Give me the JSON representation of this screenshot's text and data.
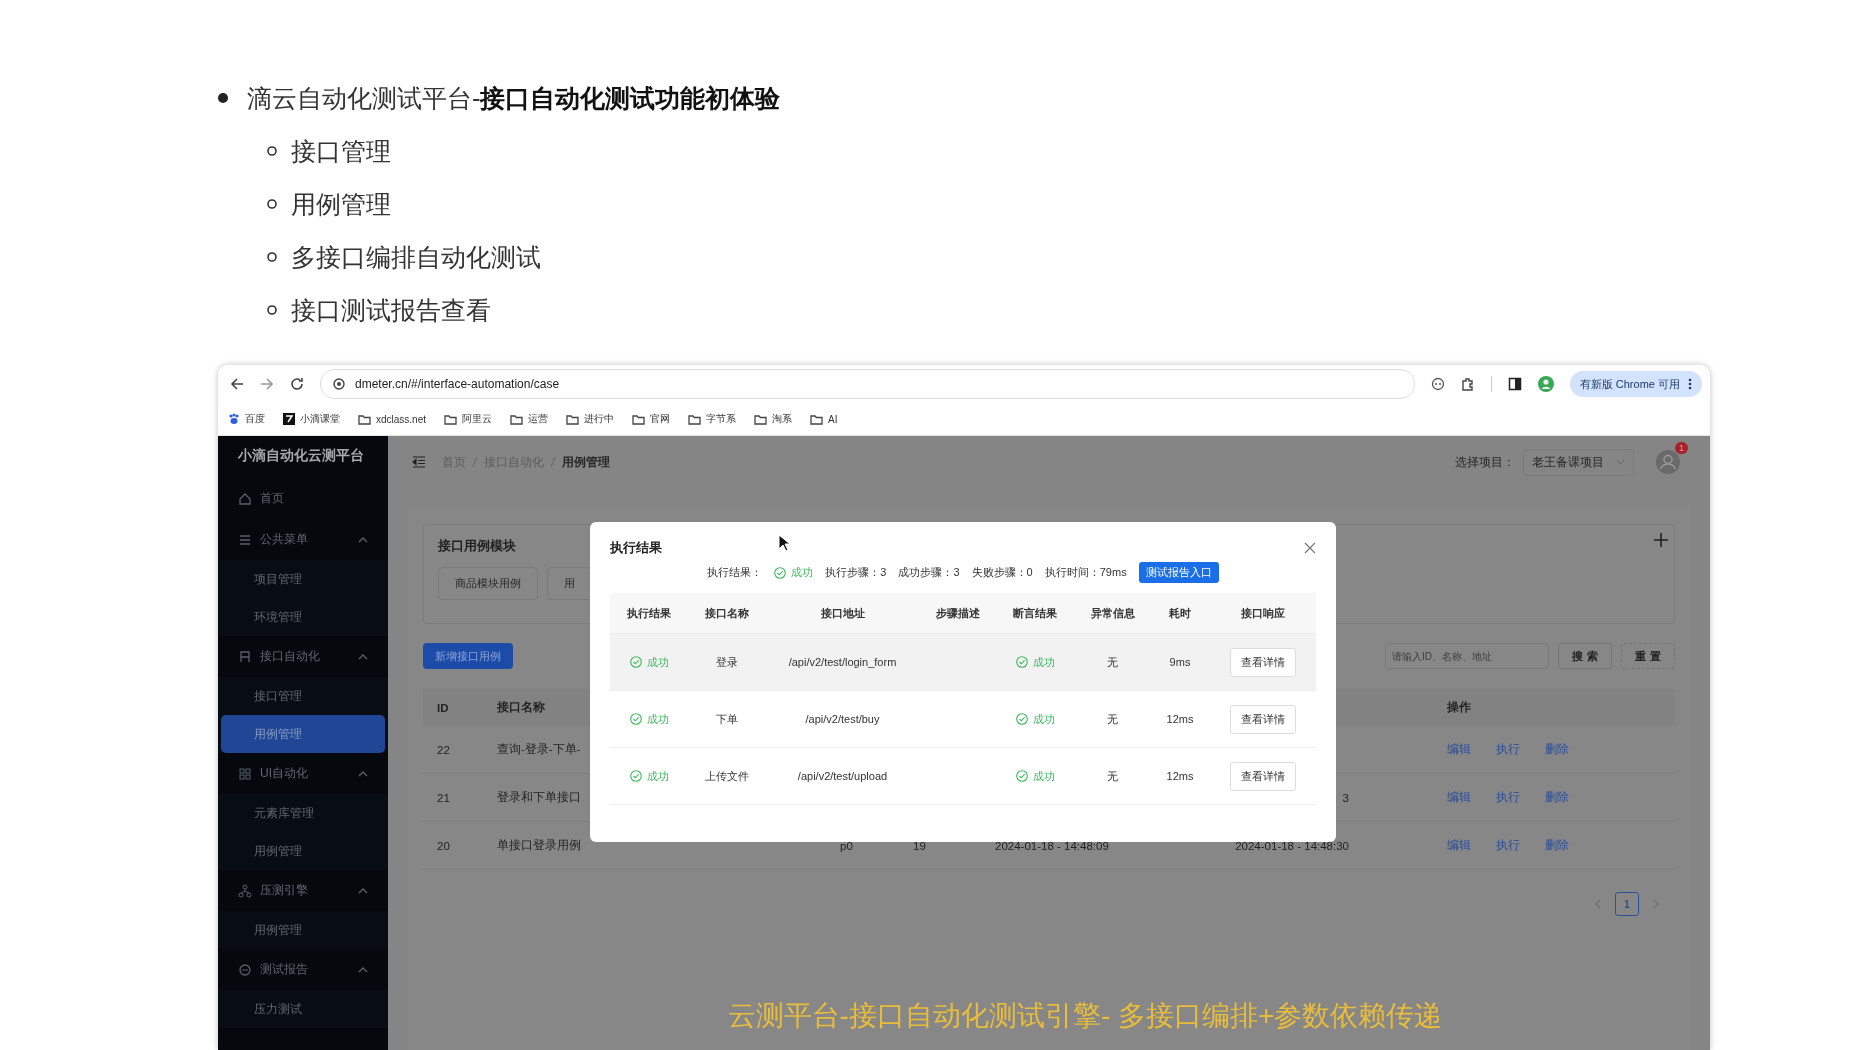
{
  "slide": {
    "heading": "滴云自动化测试平台-**接口自动化测试功能初体验**",
    "items": [
      "接口管理",
      "用例管理",
      "多接口编排自动化测试",
      "接口测试报告查看"
    ]
  },
  "browser": {
    "address": "dmeter.cn/#/interface-automation/case",
    "update_button": "有新版 Chrome 可用",
    "bookmarks": [
      {
        "label": "百度",
        "kind": "paw"
      },
      {
        "label": "小滴课堂",
        "kind": "logo"
      },
      {
        "label": "xdclass.net",
        "kind": "folder"
      },
      {
        "label": "阿里云",
        "kind": "folder"
      },
      {
        "label": "运营",
        "kind": "folder"
      },
      {
        "label": "进行中",
        "kind": "folder"
      },
      {
        "label": "官网",
        "kind": "folder"
      },
      {
        "label": "字节系",
        "kind": "folder"
      },
      {
        "label": "淘系",
        "kind": "folder"
      },
      {
        "label": "AI",
        "kind": "folder"
      }
    ]
  },
  "app": {
    "brand": "小滴自动化云测平台",
    "sidebar": {
      "items": [
        {
          "label": "首页",
          "selected": false
        },
        {
          "label": "公共菜单",
          "expanded": true,
          "children": [
            {
              "label": "项目管理",
              "selected": false
            },
            {
              "label": "环境管理",
              "selected": false
            }
          ]
        },
        {
          "label": "接口自动化",
          "expanded": true,
          "children": [
            {
              "label": "接口管理",
              "selected": false
            },
            {
              "label": "用例管理",
              "selected": true
            }
          ]
        },
        {
          "label": "UI自动化",
          "expanded": true,
          "children": [
            {
              "label": "元素库管理",
              "selected": false
            },
            {
              "label": "用例管理",
              "selected": false
            }
          ]
        },
        {
          "label": "压测引擎",
          "expanded": true,
          "children": [
            {
              "label": "用例管理",
              "selected": false
            }
          ]
        },
        {
          "label": "测试报告",
          "expanded": true,
          "children": [
            {
              "label": "压力测试",
              "selected": false
            }
          ]
        }
      ]
    },
    "header": {
      "breadcrumb": [
        "首页",
        "接口自动化",
        "用例管理"
      ],
      "project_label": "选择项目：",
      "project": "老王备课项目",
      "notification_count": "1"
    },
    "module_panel": {
      "title": "接口用例模块",
      "modules": [
        "商品模块用例",
        "用"
      ]
    },
    "add_button": "新增接口用例",
    "search": {
      "placeholder": "请输入ID、名称、地址"
    },
    "buttons": [
      "搜 索",
      "重 置"
    ],
    "table": {
      "columns": {
        "id": "ID",
        "name": "接口名称",
        "actions": "操作"
      },
      "rows": [
        {
          "id": "22",
          "name": "查询-登录-下单-",
          "actions": [
            "编辑",
            "执行",
            "删除"
          ]
        },
        {
          "id": "21",
          "name": "登录和下单接口",
          "column_6": "3",
          "actions": [
            "编辑",
            "执行",
            "删除"
          ]
        },
        {
          "id": "20",
          "name": "单接口登录用例",
          "column_3": "p0",
          "column_4": "19",
          "column_5": "2024-01-18 - 14:48:09",
          "column_6": "2024-01-18 - 14:48:30",
          "actions": [
            "编辑",
            "执行",
            "删除"
          ]
        }
      ]
    },
    "pagination": [
      {
        "label": "1",
        "selected": true
      }
    ],
    "modal": {
      "title": "执行结果",
      "summary": {
        "result_label": "执行结果：",
        "result": {
          "text": "成功",
          "success": true
        },
        "stats": [
          "执行步骤：3",
          "成功步骤：3",
          "失败步骤：0",
          "执行时间：79ms"
        ],
        "report_button": "测试报告入口"
      },
      "columns": [
        "执行结果",
        "接口名称",
        "接口地址",
        "步骤描述",
        "断言结果",
        "异常信息",
        "耗时",
        "接口响应"
      ],
      "rows": [
        {
          "result": {
            "text": "成功",
            "success": true
          },
          "name": "登录",
          "url": "/api/v2/test/login_form",
          "assertion": {
            "text": "成功",
            "success": true
          },
          "error": "无",
          "duration": "9ms",
          "action": "查看详情",
          "highlighted": true
        },
        {
          "result": {
            "text": "成功",
            "success": true
          },
          "name": "下单",
          "url": "/api/v2/test/buy",
          "assertion": {
            "text": "成功",
            "success": true
          },
          "error": "无",
          "duration": "12ms",
          "action": "查看详情",
          "highlighted": false
        },
        {
          "result": {
            "text": "成功",
            "success": true
          },
          "name": "上传文件",
          "url": "/api/v2/test/upload",
          "assertion": {
            "text": "成功",
            "success": true
          },
          "error": "无",
          "duration": "12ms",
          "action": "查看详情",
          "highlighted": false
        }
      ]
    }
  },
  "caption": "云测平台-接口自动化测试引擎- 多接口编排+参数依赖传递"
}
